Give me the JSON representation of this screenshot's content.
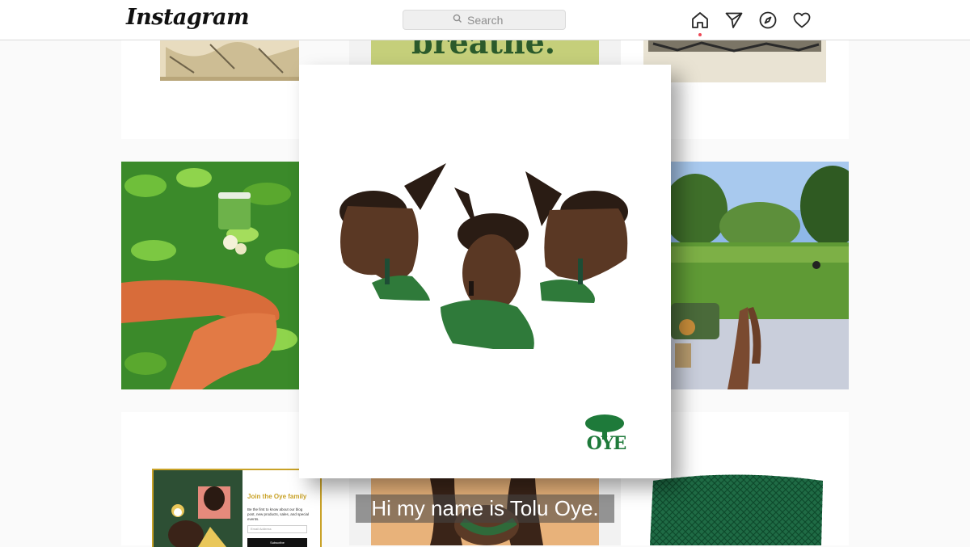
{
  "header": {
    "logo": "Instagram",
    "search": {
      "placeholder": "Search",
      "icon": "search-icon"
    },
    "nav": [
      {
        "name": "home",
        "icon": "home-icon",
        "active": true
      },
      {
        "name": "direct",
        "icon": "paper-plane-icon"
      },
      {
        "name": "explore",
        "icon": "compass-icon"
      },
      {
        "name": "activity",
        "icon": "heart-icon"
      }
    ]
  },
  "feed": {
    "posts": [
      {
        "id": "sketch-print",
        "description": "vintage print"
      },
      {
        "id": "breathe",
        "headline_fragment": "breathe."
      },
      {
        "id": "vintage-postcard",
        "description": "vintage photo card"
      },
      {
        "id": "jar-in-leaves",
        "description": "product jar held in green leaves"
      },
      {
        "id": "park-picnic",
        "description": "picnic in the park"
      },
      {
        "id": "newsletter",
        "title": "Join the Oye family",
        "body": "Be the first to know about our blog post, new products, sales, and special events.",
        "email_placeholder": "Email Address",
        "button": "Subscribe"
      },
      {
        "id": "braids-portrait",
        "description": "portrait"
      },
      {
        "id": "green-net",
        "description": "green net"
      }
    ]
  },
  "overlay": {
    "brand_mark": "OYE",
    "subtitle": "Hi my name is Tolu Oye."
  },
  "colors": {
    "brand_green": "#1e7a3a",
    "newsletter_gold": "#c9a227",
    "breathe_bg": "#c5cf7a",
    "notification_dot": "#ed4956"
  }
}
